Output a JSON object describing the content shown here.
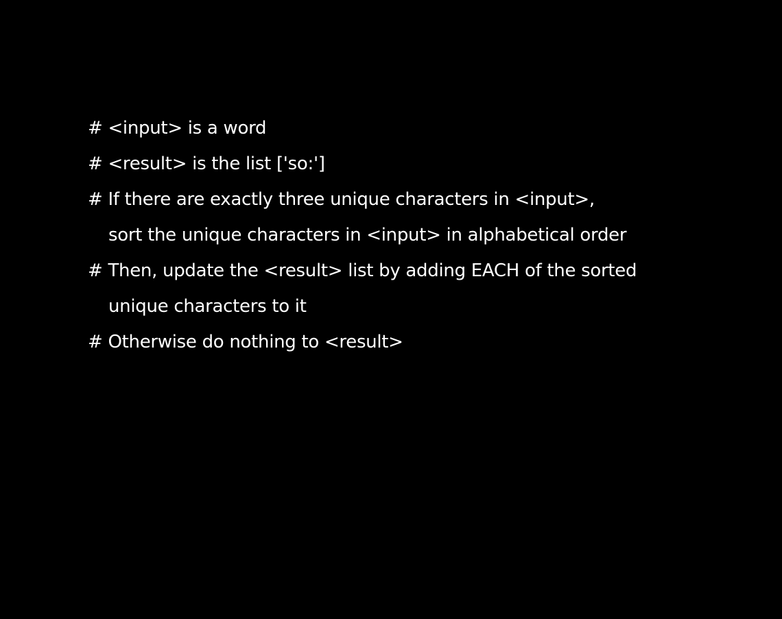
{
  "lines": [
    {
      "text": "# <input> is a word"
    },
    {
      "text": "# <result> is the list ['so:']"
    },
    {
      "text": "# If there are exactly three unique characters in <input>,"
    },
    {
      "text": "sort the unique characters in <input> in alphabetical order"
    },
    {
      "text": "# Then, update the <result> list by adding EACH of the sorted"
    },
    {
      "text": "unique characters to it"
    },
    {
      "text": "# Otherwise do nothing to <result>"
    }
  ],
  "colors": {
    "background": "#000000",
    "text": "#ffffff"
  }
}
